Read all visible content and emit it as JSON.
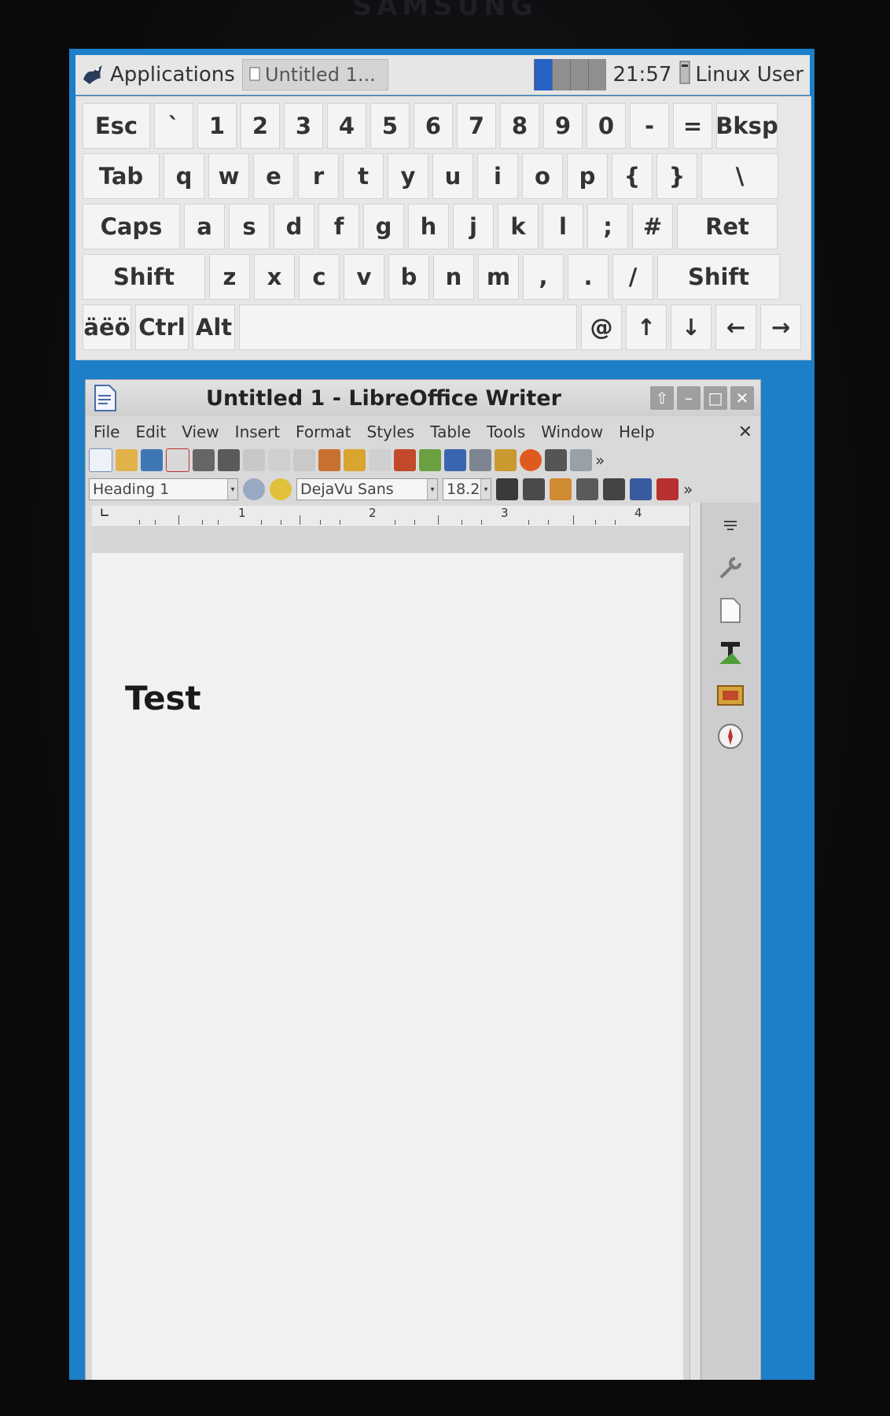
{
  "device": {
    "brand": "SAMSUNG"
  },
  "panel": {
    "apps_label": "Applications",
    "task_label": "Untitled 1...",
    "clock": "21:57",
    "user": "Linux User"
  },
  "keyboard": {
    "rows": [
      [
        "Esc",
        "`",
        "1",
        "2",
        "3",
        "4",
        "5",
        "6",
        "7",
        "8",
        "9",
        "0",
        "-",
        "=",
        "Bksp"
      ],
      [
        "Tab",
        "q",
        "w",
        "e",
        "r",
        "t",
        "y",
        "u",
        "i",
        "o",
        "p",
        "{",
        "}",
        "\\"
      ],
      [
        "Caps",
        "a",
        "s",
        "d",
        "f",
        "g",
        "h",
        "j",
        "k",
        "l",
        ";",
        "#",
        "Ret"
      ],
      [
        "Shift",
        "z",
        "x",
        "c",
        "v",
        "b",
        "n",
        "m",
        ",",
        ".",
        "/",
        "Shift"
      ],
      [
        "äëö",
        "Ctrl",
        "Alt",
        "",
        "@",
        "↑",
        "↓",
        "←",
        "→"
      ]
    ]
  },
  "writer": {
    "title": "Untitled 1 - LibreOffice Writer",
    "controls": [
      "⇧",
      "–",
      "□",
      "✕"
    ],
    "menus": [
      "File",
      "Edit",
      "View",
      "Insert",
      "Format",
      "Styles",
      "Table",
      "Tools",
      "Window",
      "Help"
    ],
    "menu_close": "✕",
    "paragraph_style": "Heading 1",
    "font_name": "DejaVu Sans",
    "font_size": "18.2",
    "ruler_numbers": [
      "1",
      "2",
      "3",
      "4"
    ],
    "document_text": "Test",
    "overflow_glyph": "»"
  },
  "colors": {
    "desktop": "#1c7fc8",
    "panel": "#e6e6e6",
    "page": "#f1f1ef",
    "active_workspace": "#2763c4"
  }
}
